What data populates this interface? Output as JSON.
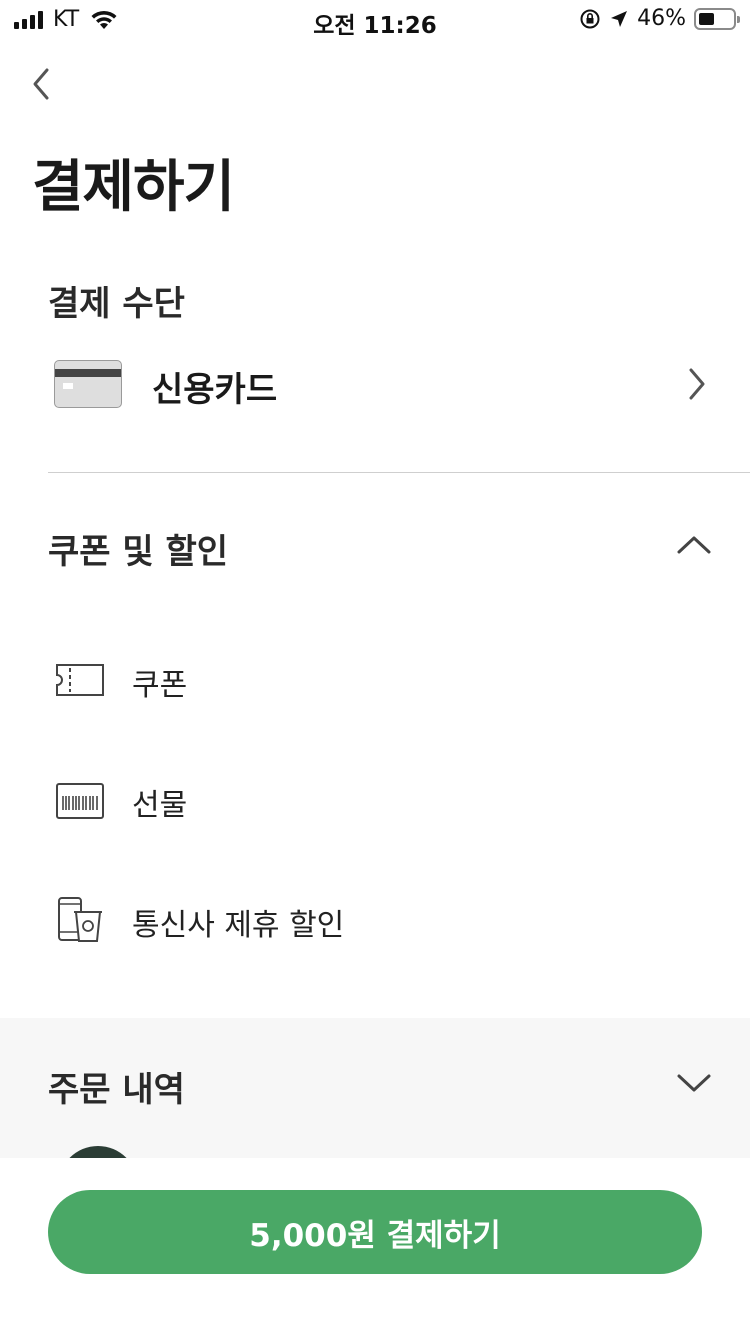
{
  "status_bar": {
    "carrier": "KT",
    "time": "오전 11:26",
    "battery_percent": "46%",
    "battery_level": 0.46
  },
  "header": {
    "back_icon": "chevron-left-icon",
    "title": "결제하기"
  },
  "payment_method": {
    "section_label": "결제 수단",
    "selected_label": "신용카드",
    "icon": "credit-card-icon"
  },
  "discounts": {
    "section_label": "쿠폰 및 할인",
    "expanded": true,
    "options": [
      {
        "label": "쿠폰",
        "icon": "coupon-ticket-icon"
      },
      {
        "label": "선물",
        "icon": "gift-card-barcode-icon"
      },
      {
        "label": "통신사 제휴 할인",
        "icon": "phone-cup-icon"
      }
    ]
  },
  "order": {
    "section_label": "주문 내역",
    "expanded": false
  },
  "footer": {
    "pay_button_label": "5,000원 결제하기"
  },
  "colors": {
    "accent_green": "#4aa866",
    "order_panel_bg": "#f7f7f7",
    "text_dark": "#1e1e1e"
  }
}
